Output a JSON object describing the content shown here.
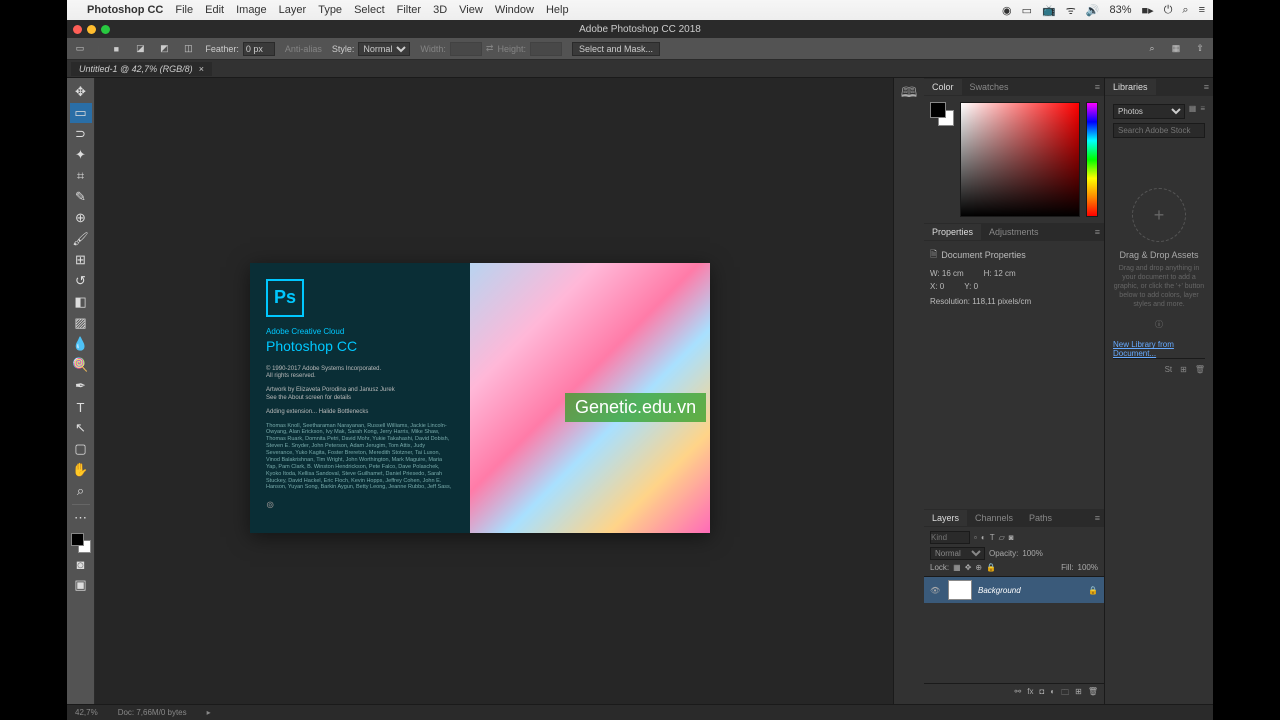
{
  "mac_menu": {
    "app": "Photoshop CC",
    "items": [
      "File",
      "Edit",
      "Image",
      "Layer",
      "Type",
      "Select",
      "Filter",
      "3D",
      "View",
      "Window",
      "Help"
    ],
    "battery": "83%"
  },
  "window_title": "Adobe Photoshop CC 2018",
  "options_bar": {
    "feather_label": "Feather:",
    "feather_value": "0 px",
    "antialias": "Anti-alias",
    "style_label": "Style:",
    "style_value": "Normal",
    "width_label": "Width:",
    "height_label": "Height:",
    "mask_btn": "Select and Mask..."
  },
  "document_tab": "Untitled-1 @ 42,7% (RGB/8)",
  "tools": [
    "move",
    "marquee",
    "lasso",
    "wand",
    "crop",
    "eyedrop",
    "heal",
    "brush",
    "stamp",
    "history",
    "eraser",
    "gradient",
    "blur",
    "dodge",
    "pen",
    "type",
    "path",
    "rect",
    "hand",
    "zoom"
  ],
  "splash": {
    "icon": "Ps",
    "line1": "Adobe Creative Cloud",
    "line2": "Photoshop CC",
    "copyright": "© 1990-2017 Adobe Systems Incorporated.\nAll rights reserved.",
    "artwork": "Artwork by Elizaveta Porodina and Janusz Jurek\nSee the About screen for details",
    "loading": "Adding extension... Halide Bottlenecks",
    "credits": "Thomas Knoll, Seetharaman Narayanan, Russell Williams, Jackie Lincoln-Owyang, Alan Erickson, Ivy Mak, Sarah Kong, Jerry Harris, Mike Shaw, Thomas Ruark, Domnita Petri, David Mohr, Yukie Takahashi, David Dobish, Steven E. Snyder, John Peterson, Adam Jerugim, Tom Attix, Judy Severance, Yuko Kagita, Foster Brereton, Meredith Stotzner, Tai Luxon, Vinod Balakrishnan, Tim Wright, John Worthington, Mark Maguire, Maria Yap, Pam Clark, B. Winston Hendrickson, Pete Falco, Dave Polaschek, Kyoko Itoda, Kellisa Sandoval, Steve Guilhamet, Daniel Priesedo, Sarah Stuckey, David Hackel, Eric Floch, Kevin Hopps, Jeffrey Cohen, John E. Hanson, Yuyan Song, Barkin Aygun, Betty Leong, Jeanne Rubbo, Jeff Sass,"
  },
  "watermark": "Genetic.edu.vn",
  "panels": {
    "color_tabs": [
      "Color",
      "Swatches"
    ],
    "props_tabs": [
      "Properties",
      "Adjustments"
    ],
    "props_header": "Document Properties",
    "props": {
      "w_label": "W:",
      "w": "16 cm",
      "h_label": "H:",
      "h": "12 cm",
      "x_label": "X:",
      "x": "0",
      "y_label": "Y:",
      "y": "0",
      "res_label": "Resolution:",
      "res": "118,11 pixels/cm"
    },
    "layers_tabs": [
      "Layers",
      "Channels",
      "Paths"
    ],
    "layers": {
      "kind_placeholder": "Kind",
      "blend": "Normal",
      "opacity_label": "Opacity:",
      "opacity": "100%",
      "lock_label": "Lock:",
      "fill_label": "Fill:",
      "fill": "100%",
      "bg_layer": "Background"
    },
    "lib_tabs": [
      "Libraries"
    ],
    "lib": {
      "select": "Photos",
      "search_placeholder": "Search Adobe Stock",
      "drop_title": "Drag & Drop Assets",
      "drop_text": "Drag and drop anything in your document to add a graphic, or click the '+' button below to add colors, layer styles and more.",
      "link": "New Library from Document..."
    }
  },
  "status": {
    "zoom": "42,7%",
    "doc": "Doc: 7,66M/0 bytes"
  }
}
